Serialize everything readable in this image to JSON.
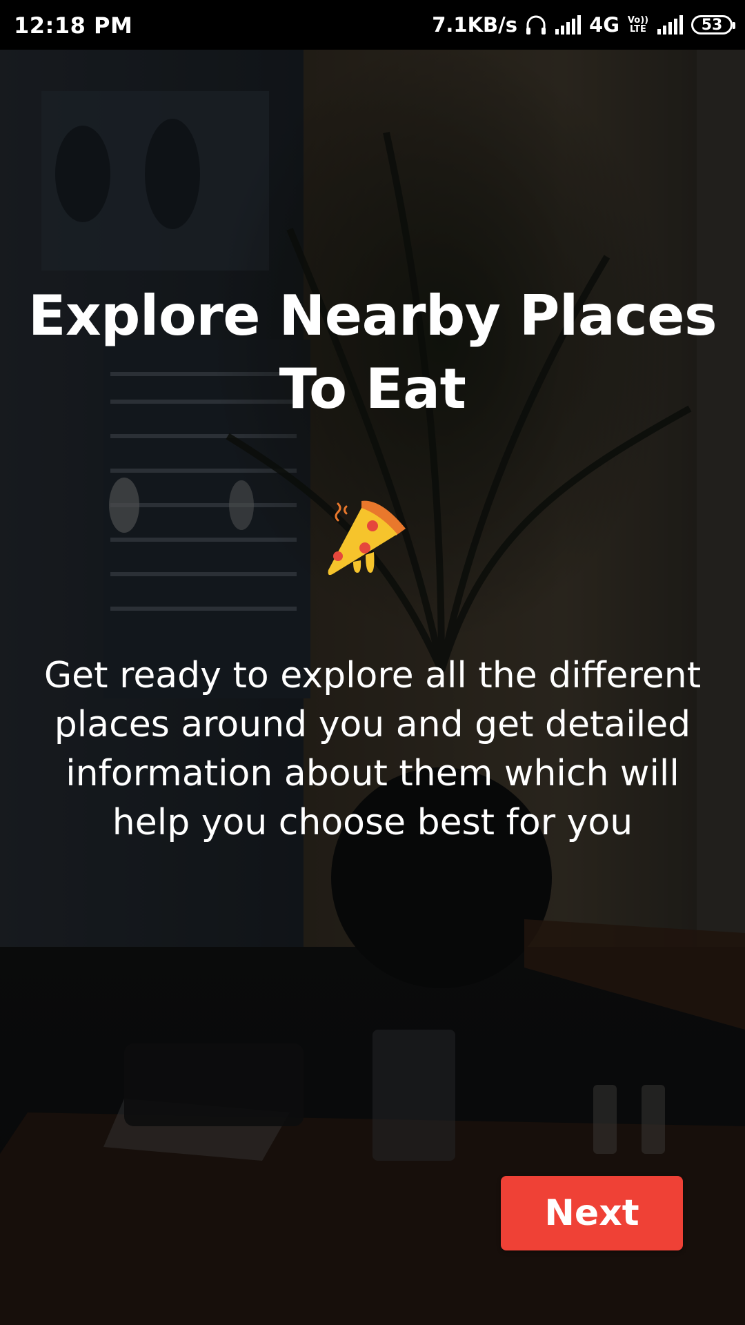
{
  "status_bar": {
    "time": "12:18 PM",
    "network_speed": "7.1KB/s",
    "network_type": "4G",
    "volte_label_top": "Vo))",
    "volte_label_bottom": "LTE",
    "battery_level": "53",
    "icons": [
      "headphones-icon",
      "signal-icon",
      "signal-icon"
    ]
  },
  "onboarding": {
    "title": "Explore Nearby Places To Eat",
    "illustration_icon": "pizza-slice-icon",
    "description": "Get ready to explore all the different places around you and get detailed information about them which will help you choose best for you",
    "next_label": "Next"
  },
  "colors": {
    "accent": "#ef4136",
    "text": "#ffffff",
    "status_bar": "#000000"
  }
}
